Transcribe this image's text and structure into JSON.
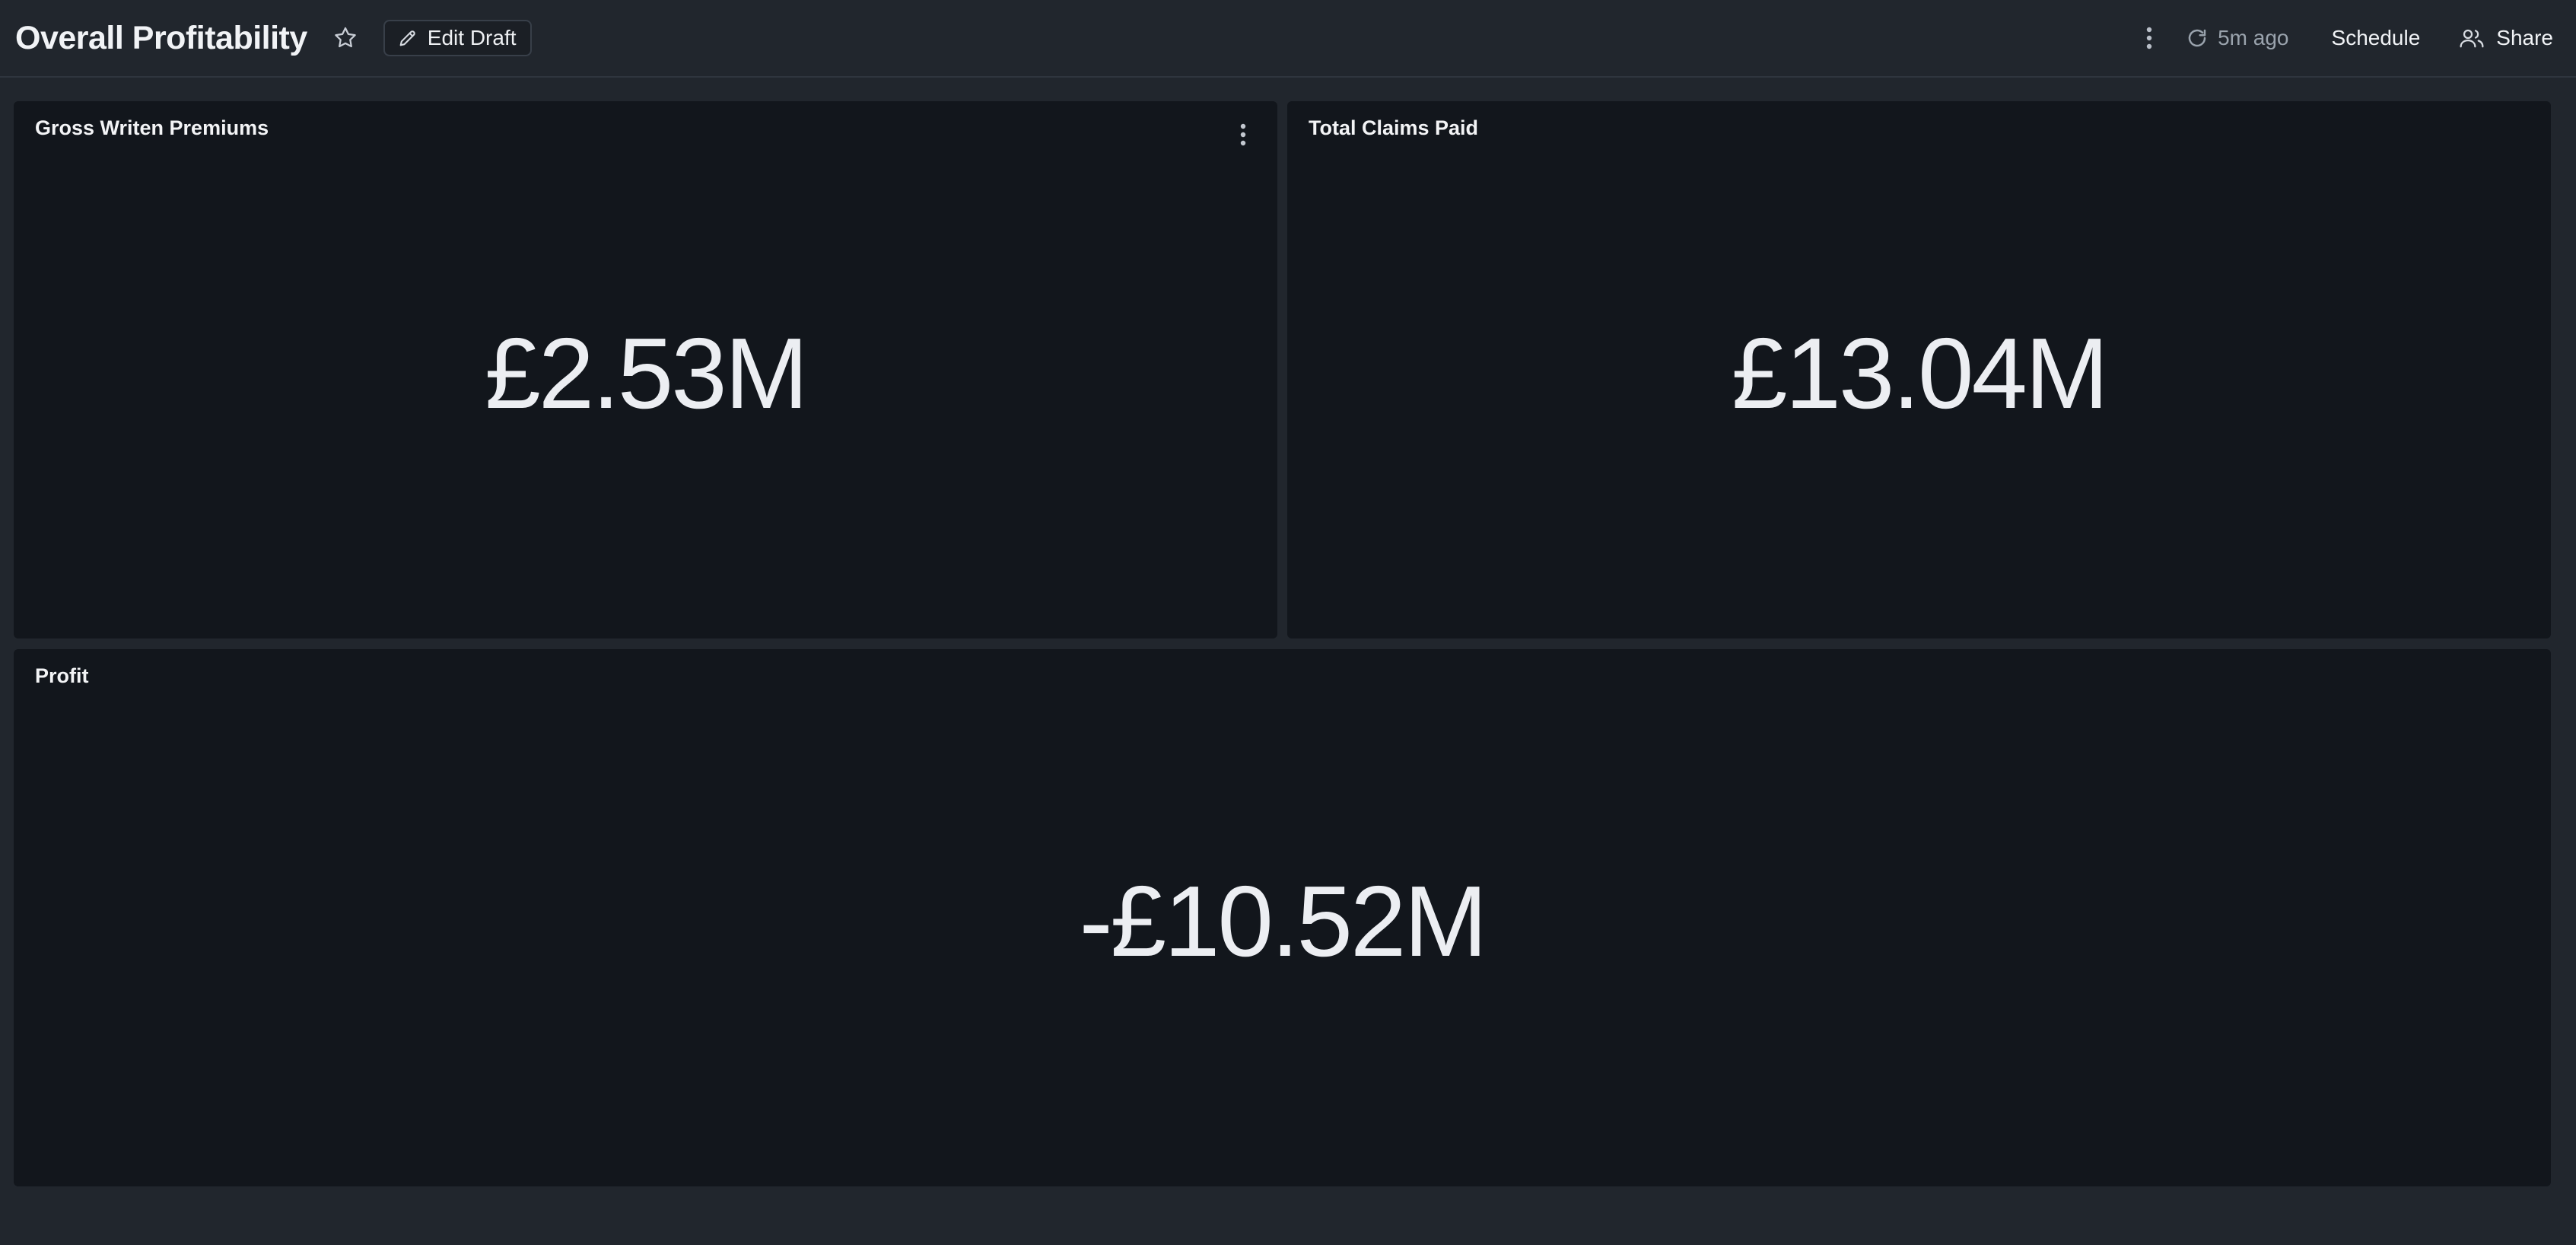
{
  "header": {
    "title": "Overall Profitability",
    "edit_draft_label": "Edit Draft",
    "refresh_label": "5m ago",
    "schedule_label": "Schedule",
    "share_label": "Share"
  },
  "tiles": [
    {
      "title": "Gross Writen Premiums",
      "value": "£2.53M"
    },
    {
      "title": "Total Claims Paid",
      "value": "£13.04M"
    },
    {
      "title": "Profit",
      "value": "-£10.52M"
    }
  ],
  "icons": {
    "favorite": "star-icon",
    "edit": "pencil-icon",
    "more": "kebab-icon",
    "refresh": "refresh-icon",
    "share": "users-icon"
  },
  "colors": {
    "page_background": "#21262d",
    "tile_background": "#12161c",
    "text_primary": "#f1f3f6",
    "text_muted": "#9aa3ad"
  }
}
